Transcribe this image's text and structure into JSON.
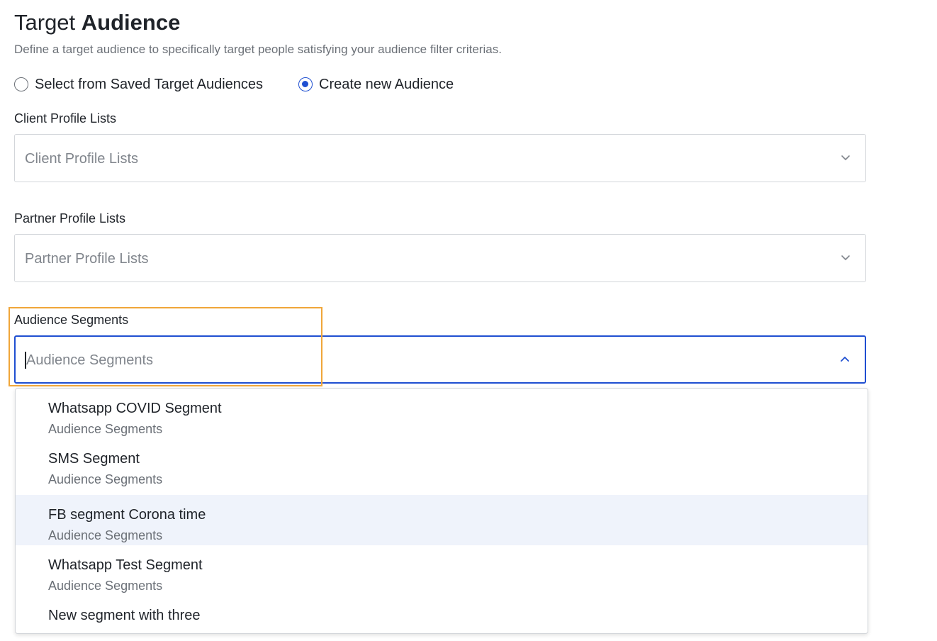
{
  "header": {
    "title_regular": "Target",
    "title_bold": "Audience",
    "subtitle": "Define a target audience to specifically target people satisfying your audience filter criterias."
  },
  "audience_mode": {
    "options": [
      {
        "label": "Select from Saved Target Audiences",
        "checked": false
      },
      {
        "label": "Create new Audience",
        "checked": true
      }
    ]
  },
  "client_profile": {
    "label": "Client Profile Lists",
    "placeholder": "Client Profile Lists"
  },
  "partner_profile": {
    "label": "Partner Profile Lists",
    "placeholder": "Partner Profile Lists"
  },
  "audience_segments": {
    "label": "Audience Segments",
    "placeholder": "Audience Segments",
    "options": [
      {
        "title": "Whatsapp COVID Segment",
        "group": "Audience Segments"
      },
      {
        "title": "SMS Segment",
        "group": "Audience Segments"
      },
      {
        "title": "FB segment Corona time",
        "group": "Audience Segments"
      },
      {
        "title": "Whatsapp Test Segment",
        "group": "Audience Segments"
      },
      {
        "title": "New segment with three",
        "group": ""
      }
    ]
  },
  "icons": {
    "collapsed": "chevron-down-icon",
    "expanded": "chevron-up-icon"
  },
  "colors": {
    "accent": "#1f4fd1",
    "highlight": "#f0a63a",
    "hover_row": "#eff3fb"
  }
}
